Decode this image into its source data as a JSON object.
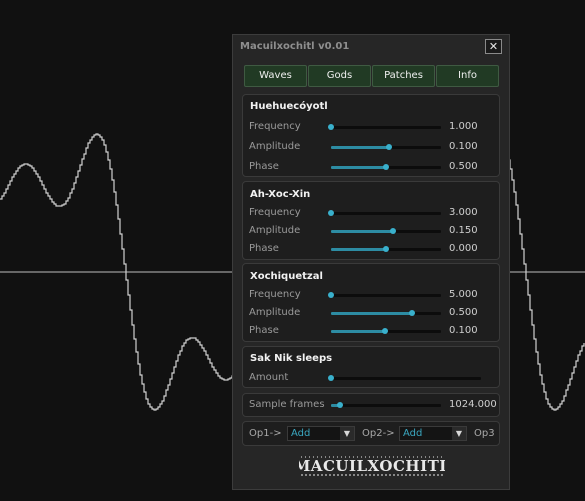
{
  "window": {
    "title": "Macuilxochitl v0.01",
    "close_glyph": "✕"
  },
  "tabs": [
    "Waves",
    "Gods",
    "Patches",
    "Info"
  ],
  "gods": [
    {
      "name": "Huehuecóyotl",
      "params": [
        {
          "label": "Frequency",
          "value": "1.000",
          "level": 0.0
        },
        {
          "label": "Amplitude",
          "value": "0.100",
          "level": 0.53
        },
        {
          "label": "Phase",
          "value": "0.500",
          "level": 0.5
        }
      ]
    },
    {
      "name": "Ah-Xoc-Xin",
      "params": [
        {
          "label": "Frequency",
          "value": "3.000",
          "level": 0.0
        },
        {
          "label": "Amplitude",
          "value": "0.150",
          "level": 0.56
        },
        {
          "label": "Phase",
          "value": "0.000",
          "level": 0.5
        }
      ]
    },
    {
      "name": "Xochiquetzal",
      "params": [
        {
          "label": "Frequency",
          "value": "5.000",
          "level": 0.0
        },
        {
          "label": "Amplitude",
          "value": "0.500",
          "level": 0.74
        },
        {
          "label": "Phase",
          "value": "0.100",
          "level": 0.49
        }
      ]
    }
  ],
  "sak_nik": {
    "title": "Sak Nik sleeps",
    "label": "Amount",
    "level": 0.0
  },
  "sample_frames": {
    "label": "Sample frames",
    "value": "1024.000",
    "level": 0.08
  },
  "ops": {
    "op1_label": "Op1->",
    "op1_value": "Add",
    "op2_label": "Op2->",
    "op2_value": "Add",
    "op3_label": "Op3",
    "arrow": "▼"
  },
  "logo_text": "MACUILXOCHITL",
  "colors": {
    "accent": "#39b0cc",
    "tab_bg": "#213a24",
    "waveform": "#d0d0d0",
    "background": "#111111"
  }
}
